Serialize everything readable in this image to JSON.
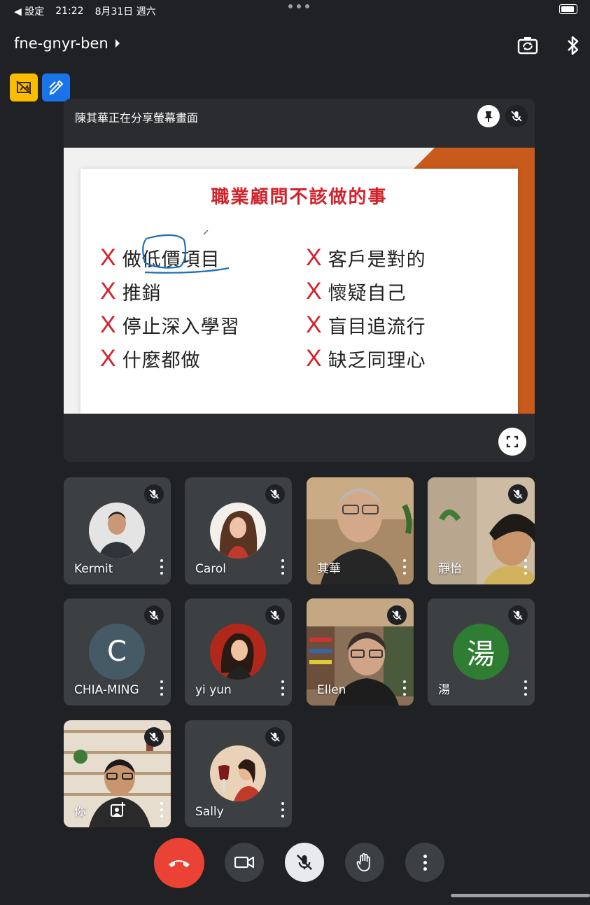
{
  "status_bar": {
    "back_label": "◀ 設定",
    "time": "21:22",
    "date": "8月31日 週六"
  },
  "header": {
    "meeting_code": "fne-gnyr-ben"
  },
  "presentation": {
    "banner": "陳其華正在分享螢幕畫面",
    "slide": {
      "title": "職業顧問不該做的事",
      "left_items": [
        "做低價項目",
        "推銷",
        "停止深入學習",
        "什麼都做"
      ],
      "right_items": [
        "客戶是對的",
        "懷疑自己",
        "盲目追流行",
        "缺乏同理心"
      ],
      "mark": "X"
    }
  },
  "participants": [
    {
      "name": "Kermit",
      "muted": true,
      "avatar_type": "photo"
    },
    {
      "name": "Carol",
      "muted": true,
      "avatar_type": "photo"
    },
    {
      "name": "其華",
      "muted": false,
      "avatar_type": "video"
    },
    {
      "name": "靜怡",
      "muted": true,
      "avatar_type": "video"
    },
    {
      "name": "CHIA-MING",
      "muted": true,
      "avatar_type": "letter",
      "letter": "C",
      "color": "#455a64"
    },
    {
      "name": "yi yun",
      "muted": true,
      "avatar_type": "photo"
    },
    {
      "name": "Ellen",
      "muted": true,
      "avatar_type": "video"
    },
    {
      "name": "湯",
      "muted": true,
      "avatar_type": "letter",
      "letter": "湯",
      "color": "#2e7d32"
    },
    {
      "name": "你",
      "muted": true,
      "avatar_type": "video"
    },
    {
      "name": "Sally",
      "muted": true,
      "avatar_type": "photo"
    }
  ],
  "colors": {
    "background": "#202124",
    "tile": "#3c4043",
    "hangup": "#ea4335",
    "accent_red": "#d4202a",
    "tool_yellow": "#fbbc04",
    "tool_blue": "#1a73e8"
  },
  "icons": {
    "bluetooth": "bluetooth-icon",
    "camera_switch": "camera-switch-icon",
    "pin": "pin-icon",
    "mic_off": "mic-off-icon",
    "fullscreen": "fullscreen-icon",
    "hangup": "hangup-icon",
    "camera": "camera-icon",
    "raise_hand": "raise-hand-icon",
    "more": "more-vert-icon"
  }
}
